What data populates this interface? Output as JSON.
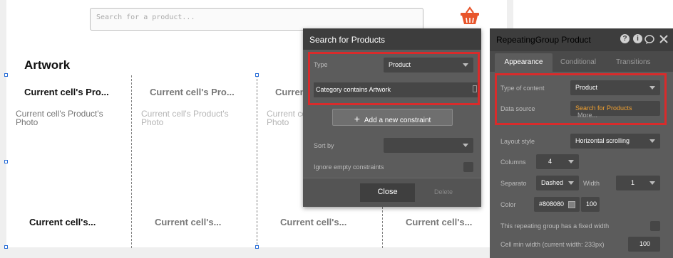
{
  "canvas": {
    "search_placeholder": "Search for a product...",
    "cart_icon": "shopping-basket-icon",
    "cart_color": "#e8552b",
    "group_title": "Artwork",
    "cells": [
      {
        "title": "Current cell's Pro...",
        "photo": "Current cell's Product's Photo",
        "bottom": "Current cell's..."
      },
      {
        "title": "Current cell's Pro...",
        "photo": "Current cell's Product's Photo",
        "bottom": "Current cell's..."
      },
      {
        "title": "Current cell's Pro...",
        "photo": "Current cell's Product's Photo",
        "bottom": "Current cell's..."
      },
      {
        "bottom": "Current cell's..."
      }
    ]
  },
  "search_panel": {
    "title": "Search for Products",
    "type_label": "Type",
    "type_value": "Product",
    "constraint": "Category contains  Artwork",
    "add_constraint": "Add a new constraint",
    "sort_label": "Sort by",
    "sort_value": "",
    "ignore_label": "Ignore empty constraints",
    "ignore_checked": false,
    "close_label": "Close",
    "delete_label": "Delete"
  },
  "group_panel": {
    "title": "RepeatingGroup Product",
    "tabs": [
      "Appearance",
      "Conditional",
      "Transitions"
    ],
    "active_tab": "Appearance",
    "type_of_content_label": "Type of content",
    "type_of_content_value": "Product",
    "data_source_label": "Data source",
    "data_source_value": "Search for Products",
    "data_source_more": "More...",
    "layout_style_label": "Layout style",
    "layout_style_value": "Horizontal scrolling",
    "columns_label": "Columns",
    "columns_value": "4",
    "separator_label": "Separato",
    "separator_value": "Dashed",
    "width_label": "Width",
    "width_value": "1",
    "color_label": "Color",
    "color_value": "#808080",
    "color_opacity": "100",
    "fixed_width_label": "This repeating group has a fixed width",
    "min_width_label": "Cell min width (current width: 233px)",
    "min_width_value": "100"
  },
  "colors": {
    "accent_highlight": "#d92b2b",
    "link_orange": "#f0a030",
    "panel_dark": "#3d3d3d"
  }
}
